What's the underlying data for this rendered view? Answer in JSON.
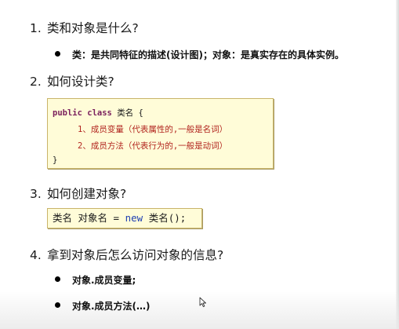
{
  "sections": [
    {
      "num": "1.",
      "title": "类和对象是什么?"
    },
    {
      "num": "2.",
      "title": "如何设计类?"
    },
    {
      "num": "3.",
      "title": "如何创建对象?"
    },
    {
      "num": "4.",
      "title": "拿到对象后怎么访问对象的信息?"
    }
  ],
  "bullet1": "类：是共同特征的描述(设计图)；对象：是真实存在的具体实例。",
  "class_code": {
    "kw": "public class",
    "name": "类名 {",
    "line1": "1、成员变量（代表属性的,一般是名词）",
    "line2": "2、成员方法（代表行为的,一般是动词）",
    "close": "}"
  },
  "create_code": {
    "before": "类名 对象名 = ",
    "kw": "new",
    "after": " 类名();"
  },
  "access_bullets": [
    "对象.成员变量;",
    "对象.成员方法(…)"
  ],
  "colors": {
    "code_bg": "#fffcd8",
    "keyword": "#7a1f5c",
    "comment": "#b2251f",
    "new_keyword": "#1f3fb2"
  },
  "icons": [
    "bullet-dot-icon",
    "mouse-cursor-icon"
  ]
}
